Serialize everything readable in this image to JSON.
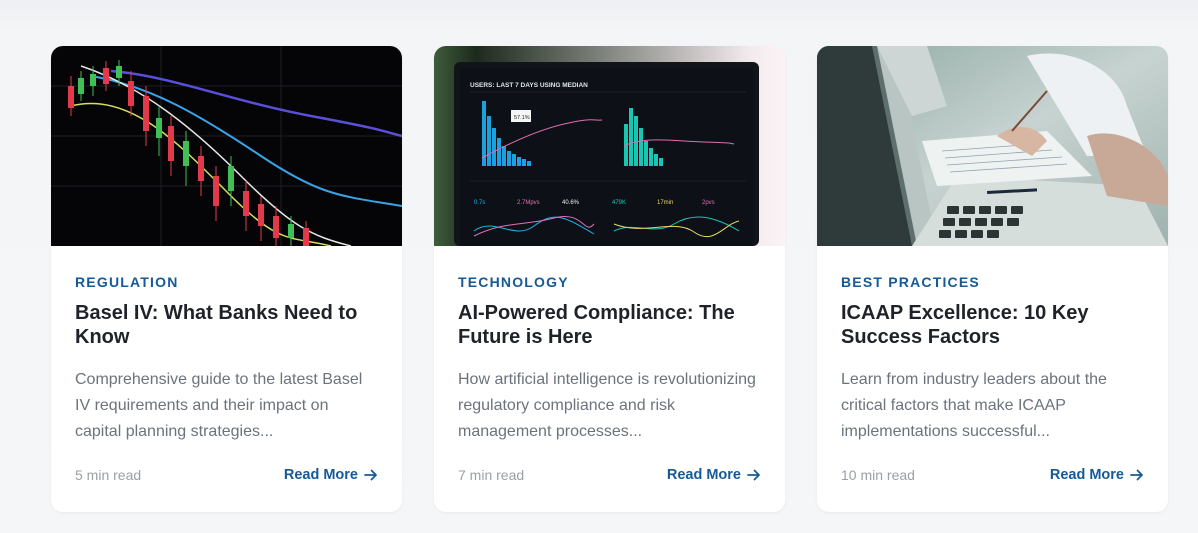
{
  "colors": {
    "accent": "#155a96",
    "title": "#1f2329",
    "muted": "#6c737c",
    "light": "#9aa0a6"
  },
  "cards": [
    {
      "image": "stock-candlestick-chart",
      "category": "REGULATION",
      "title": "Basel IV: What Banks Need to Know",
      "excerpt": "Comprehensive guide to the latest Basel IV requirements and their impact on capital planning strategies...",
      "read_time": "5 min read",
      "cta": "Read More"
    },
    {
      "image": "analytics-dashboard-laptop",
      "category": "TECHNOLOGY",
      "title": "AI-Powered Compliance: The Future is Here",
      "excerpt": "How artificial intelligence is revolutionizing regulatory compliance and risk management processes...",
      "read_time": "7 min read",
      "cta": "Read More",
      "dashboard": {
        "header": "USERS: LAST 7 DAYS USING MEDIAN",
        "tooltip": "57.1%",
        "metrics": [
          "0.7s",
          "2.7Mpvs",
          "40.6%",
          "479K",
          "17min",
          "2pvs"
        ]
      }
    },
    {
      "image": "laptop-paperwork-desk",
      "category": "BEST PRACTICES",
      "title": "ICAAP Excellence: 10 Key Success Factors",
      "excerpt": "Learn from industry leaders about the critical factors that make ICAAP implementations successful...",
      "read_time": "10 min read",
      "cta": "Read More"
    }
  ]
}
